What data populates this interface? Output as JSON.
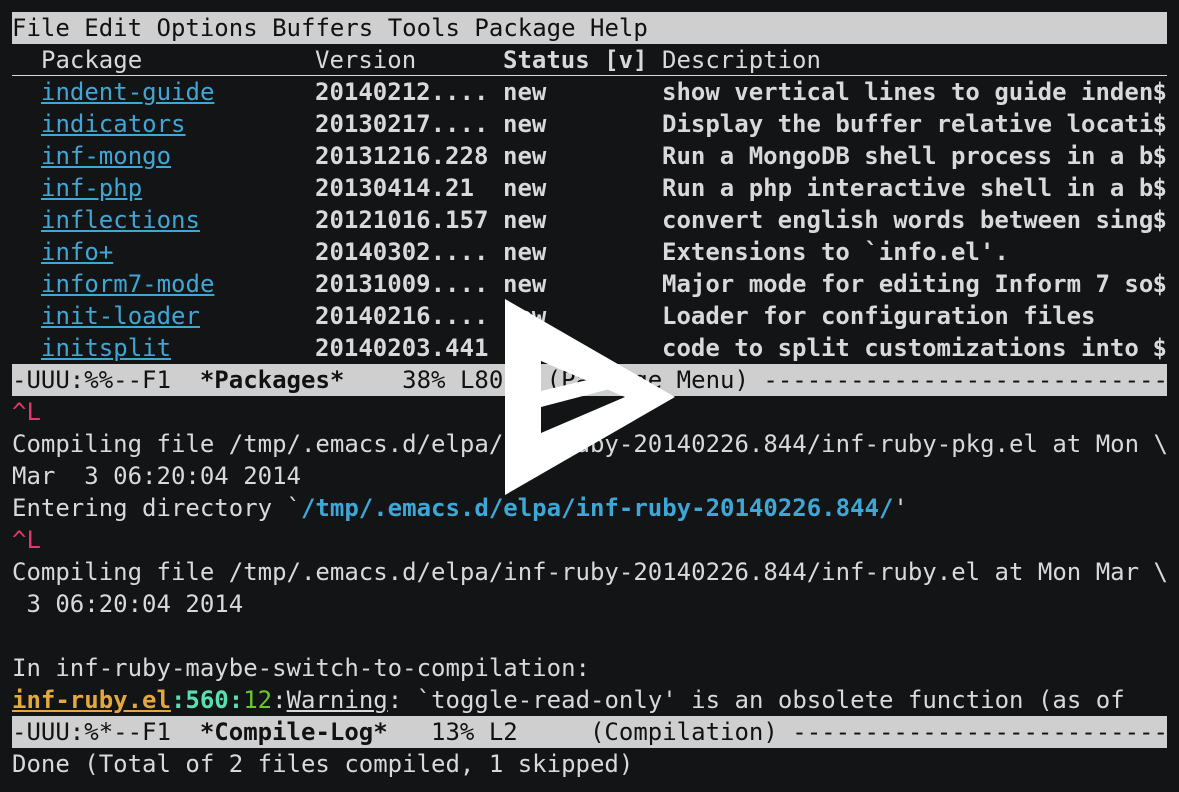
{
  "menu": [
    "File",
    "Edit",
    "Options",
    "Buffers",
    "Tools",
    "Package",
    "Help"
  ],
  "table": {
    "headers": {
      "package": "Package",
      "version": "Version",
      "status": "Status [v]",
      "description": "Description"
    },
    "rows": [
      {
        "name": "indent-guide",
        "version": "20140212....",
        "status": "new",
        "description": "show vertical lines to guide inden",
        "trunc": "$"
      },
      {
        "name": "indicators",
        "version": "20130217....",
        "status": "new",
        "description": "Display the buffer relative locati",
        "trunc": "$"
      },
      {
        "name": "inf-mongo",
        "version": "20131216.228",
        "status": "new",
        "description": "Run a MongoDB shell process in a b",
        "trunc": "$"
      },
      {
        "name": "inf-php",
        "version": "20130414.21",
        "status": "new",
        "description": "Run a php interactive shell in a b",
        "trunc": "$"
      },
      {
        "name": "inflections",
        "version": "20121016.157",
        "status": "new",
        "description": "convert english words between sing",
        "trunc": "$"
      },
      {
        "name": "info+",
        "version": "20140302....",
        "status": "new",
        "description": "Extensions to `info.el'.",
        "trunc": ""
      },
      {
        "name": "inform7-mode",
        "version": "20131009....",
        "status": "new",
        "description": "Major mode for editing Inform 7 so",
        "trunc": "$"
      },
      {
        "name": "init-loader",
        "version": "20140216....",
        "status": "new",
        "description": "Loader for configuration files",
        "trunc": ""
      },
      {
        "name": "initsplit",
        "version": "20140203.441",
        "status": "new",
        "description": "code to split customizations into ",
        "trunc": "$"
      }
    ]
  },
  "modeline1": {
    "prefix": "-UUU:%%--F1  ",
    "buffer": "*Packages*",
    "suffix": "    38% L80   (Package Menu) ------------------------------------------"
  },
  "log": {
    "ctrl1": "^L",
    "compile1a": "Compiling file /tmp/.emacs.d/elpa/inf-ruby-20140226.844/inf-ruby-pkg.el at Mon \\",
    "compile1b": "Mar  3 06:20:04 2014",
    "enter_prefix": "Entering directory `",
    "enter_dir": "/tmp/.emacs.d/elpa/inf-ruby-20140226.844/",
    "enter_suffix": "'",
    "ctrl2": "^L",
    "compile2a": "Compiling file /tmp/.emacs.d/elpa/inf-ruby-20140226.844/inf-ruby.el at Mon Mar \\",
    "compile2b": " 3 06:20:04 2014",
    "in_fn": "In inf-ruby-maybe-switch-to-compilation:",
    "warn_file": "inf-ruby.el",
    "warn_line": "560",
    "warn_col": "12",
    "warn_label": "Warning",
    "warn_msg": ": `toggle-read-only' is an obsolete function (as of"
  },
  "modeline2": {
    "prefix": "-UUU:%*--F1  ",
    "buffer": "*Compile-Log*",
    "suffix": "   13% L2     (Compilation) ------------------------------------------"
  },
  "echo": "Done (Total of 2 files compiled, 1 skipped)",
  "overlay": {
    "icon": "play-icon",
    "color": "#ffffff"
  }
}
